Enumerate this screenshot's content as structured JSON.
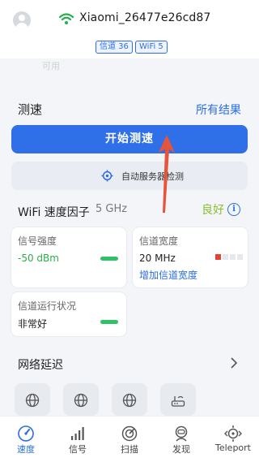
{
  "header": {
    "ssid": "Xiaomi_26477e26cd87",
    "channel_badge": "信道 36",
    "wifi_badge": "WiFi 5",
    "status_faded": "可用"
  },
  "speed_test": {
    "title": "测速",
    "all_results": "所有结果",
    "start_button": "开始测速",
    "auto_server": "自动服务器检测"
  },
  "factors": {
    "title": "WiFi 速度因子",
    "band": "5 GHz",
    "rating": "良好",
    "cards": [
      {
        "label": "信号强度",
        "value": "-50 dBm"
      },
      {
        "label": "信道宽度",
        "value": "20 MHz",
        "link": "增加信道宽度"
      },
      {
        "label": "信道运行状况",
        "value": "非常好"
      }
    ]
  },
  "latency": {
    "title": "网络延迟"
  },
  "nav": [
    {
      "label": "速度",
      "icon": "speedometer-icon",
      "active": true
    },
    {
      "label": "信号",
      "icon": "signal-bars-icon",
      "active": false
    },
    {
      "label": "扫描",
      "icon": "scan-icon",
      "active": false
    },
    {
      "label": "发现",
      "icon": "discover-icon",
      "active": false
    },
    {
      "label": "Teleport",
      "icon": "teleport-icon",
      "active": false
    }
  ],
  "colors": {
    "primary": "#2f6fe8",
    "good": "#8bbe2f",
    "signal_green": "#2bb04a",
    "arrow": "#e4553a"
  }
}
